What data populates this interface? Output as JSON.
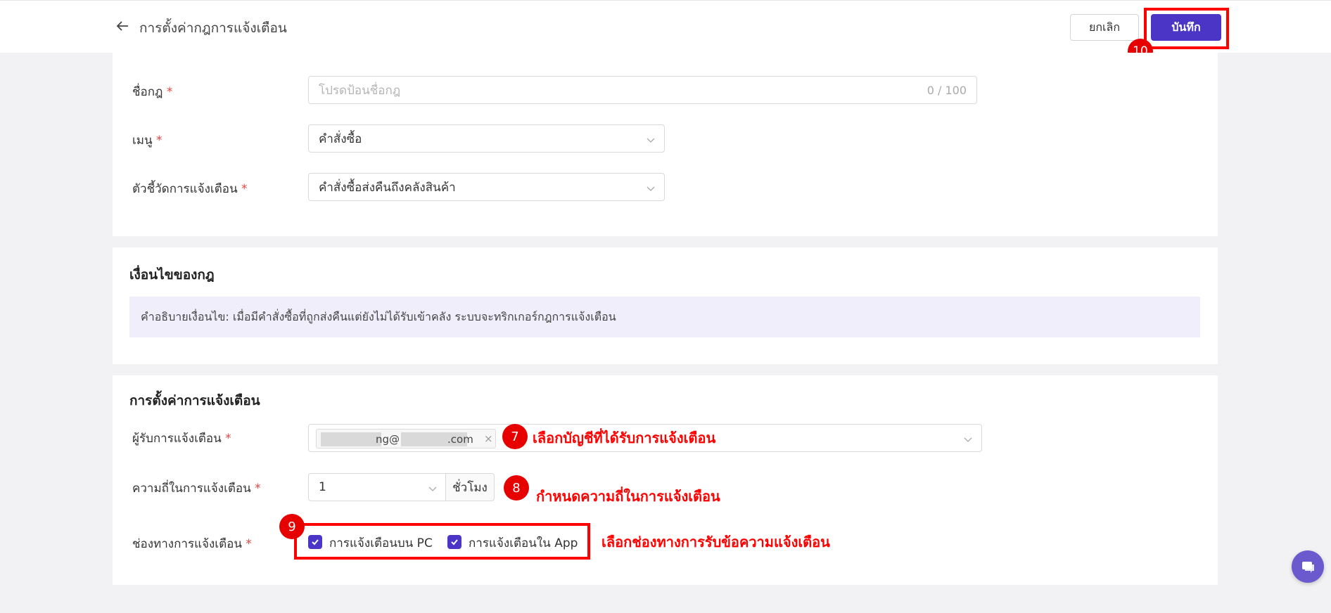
{
  "header": {
    "title": "การตั้งค่ากฎการแจ้งเตือน",
    "cancel_label": "ยกเลิก",
    "save_label": "บันทึก"
  },
  "rule_info": {
    "name_label": "ชื่อกฎ",
    "name_placeholder": "โปรดป้อนชื่อกฎ",
    "name_counter": "0 / 100",
    "menu_label": "เมนู",
    "menu_value": "คำสั่งซื้อ",
    "indicator_label": "ตัวชี้วัดการแจ้งเตือน",
    "indicator_value": "คำสั่งซื้อส่งคืนถึงคลังสินค้า"
  },
  "conditions": {
    "title": "เงื่อนไขของกฎ",
    "description": "คำอธิบายเงื่อนไข: เมื่อมีคำสั่งซื้อที่ถูกส่งคืนแต่ยังไม่ได้รับเข้าคลัง ระบบจะทริกเกอร์กฎการแจ้งเตือน"
  },
  "notification_settings": {
    "title": "การตั้งค่าการแจ้งเตือน",
    "recipient_label": "ผู้รับการแจ้งเตือน",
    "recipient_tag_part1": "ng@",
    "recipient_tag_part2": ".com",
    "frequency_label": "ความถี่ในการแจ้งเตือน",
    "frequency_value": "1",
    "frequency_unit": "ชั่วโมง",
    "channel_label": "ช่องทางการแจ้งเตือน",
    "channels": [
      {
        "label": "การแจ้งเตือนบน PC",
        "checked": true
      },
      {
        "label": "การแจ้งเตือนใน App",
        "checked": true
      }
    ]
  },
  "annotations": {
    "badge_7": "7",
    "badge_8": "8",
    "badge_9": "9",
    "badge_10": "10",
    "text_7": "เลือกบัญชีที่ได้รับการแจ้งเตือน",
    "text_8": "กำหนดความถี่ในการแจ้งเตือน",
    "text_9": "เลือกช่องทางการรับข้อความแจ้งเตือน"
  },
  "colors": {
    "primary": "#4a35c7",
    "annotation_red": "#ff0000",
    "required_red": "#e54545",
    "description_bg": "#f0eefb"
  },
  "icons": [
    "arrow-left-icon",
    "chevron-down-icon",
    "close-icon",
    "check-icon",
    "chat-icon"
  ]
}
